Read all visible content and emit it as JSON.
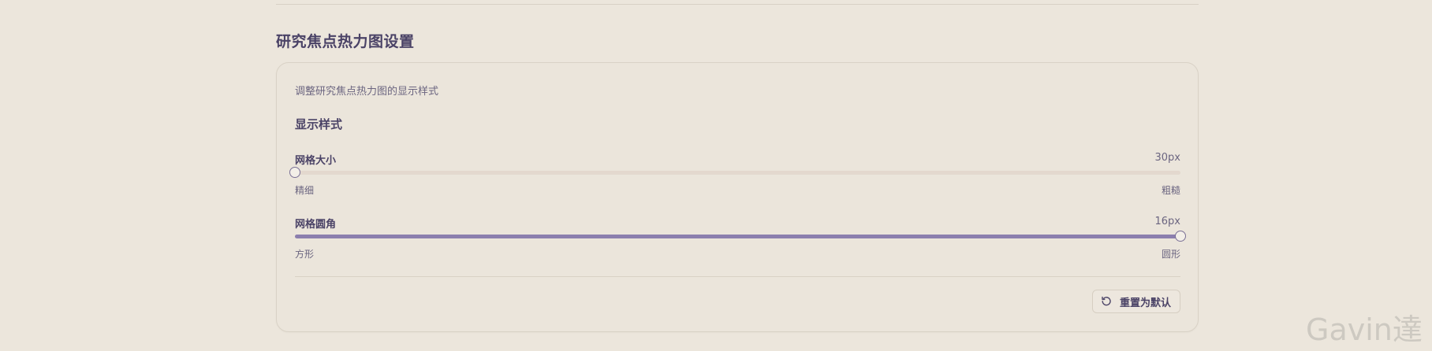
{
  "section": {
    "title": "研究焦点热力图设置"
  },
  "card": {
    "description": "调整研究焦点热力图的显示样式",
    "group_title": "显示样式"
  },
  "settings": [
    {
      "label": "网格大小",
      "value": "30px",
      "min_label": "精细",
      "max_label": "粗糙",
      "level": 0.0
    },
    {
      "label": "网格圆角",
      "value": "16px",
      "min_label": "方形",
      "max_label": "圆形",
      "level": 1.0
    }
  ],
  "reset_button": {
    "label": "重置为默认",
    "icon": "rotate-ccw-icon"
  },
  "watermark": "Gavin達",
  "colors": {
    "background": "#ece6dc",
    "accent": "#8c7fae",
    "track": "#e3d8ce",
    "text": "#4a4266"
  }
}
